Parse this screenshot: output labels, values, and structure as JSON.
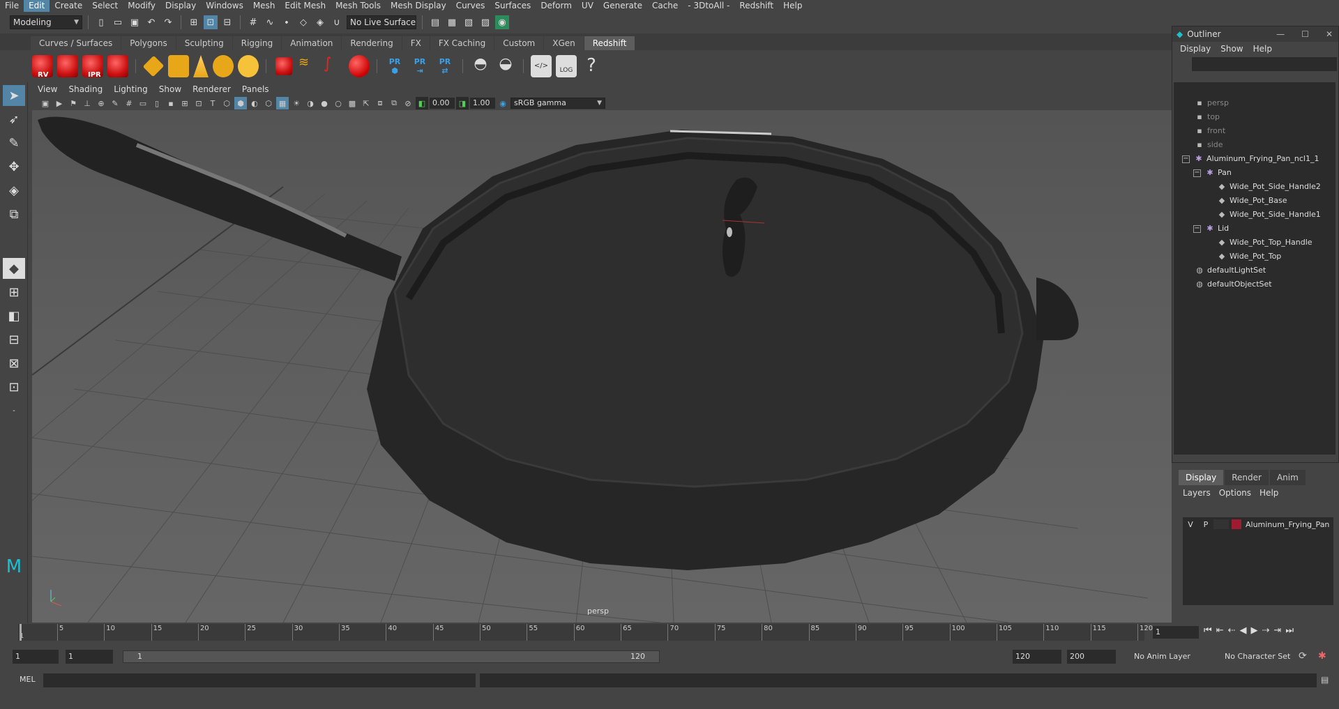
{
  "menubar": [
    "File",
    "Edit",
    "Create",
    "Select",
    "Modify",
    "Display",
    "Windows",
    "Mesh",
    "Edit Mesh",
    "Mesh Tools",
    "Mesh Display",
    "Curves",
    "Surfaces",
    "Deform",
    "UV",
    "Generate",
    "Cache",
    "- 3DtoAll -",
    "Redshift",
    "Help"
  ],
  "statusline": {
    "mode": "Modeling",
    "live_surface": "No Live Surface"
  },
  "shelf_tabs": [
    "Curves / Surfaces",
    "Polygons",
    "Sculpting",
    "Rigging",
    "Animation",
    "Rendering",
    "FX",
    "FX Caching",
    "Custom",
    "XGen",
    "Redshift"
  ],
  "shelf_icons": {
    "rv": "RV",
    "ipr": "IPR",
    "pr1": "PR",
    "pr2": "PR",
    "pr3": "PR",
    "log": "LOG"
  },
  "panel_menu": [
    "View",
    "Shading",
    "Lighting",
    "Show",
    "Renderer",
    "Panels"
  ],
  "panel_tools": {
    "exposure": "0.00",
    "gamma": "1.00",
    "colorspace": "sRGB gamma"
  },
  "viewport": {
    "camera_label": "persp"
  },
  "outliner": {
    "title": "Outliner",
    "menu": [
      "Display",
      "Show",
      "Help"
    ],
    "items": [
      {
        "label": "persp",
        "dim": true
      },
      {
        "label": "top",
        "dim": true
      },
      {
        "label": "front",
        "dim": true
      },
      {
        "label": "side",
        "dim": true
      },
      {
        "label": "Aluminum_Frying_Pan_ncl1_1"
      },
      {
        "label": "Pan"
      },
      {
        "label": "Wide_Pot_Side_Handle2"
      },
      {
        "label": "Wide_Pot_Base"
      },
      {
        "label": "Wide_Pot_Side_Handle1"
      },
      {
        "label": "Lid"
      },
      {
        "label": "Wide_Pot_Top_Handle"
      },
      {
        "label": "Wide_Pot_Top"
      },
      {
        "label": "defaultLightSet"
      },
      {
        "label": "defaultObjectSet"
      }
    ]
  },
  "layer_editor": {
    "tabs": [
      "Display",
      "Render",
      "Anim"
    ],
    "menu": [
      "Layers",
      "Options",
      "Help"
    ],
    "layer": {
      "v": "V",
      "p": "P",
      "name": "Aluminum_Frying_Pan",
      "color": "#9e1b32"
    }
  },
  "timeslider": {
    "ticks": [
      "5",
      "10",
      "15",
      "20",
      "25",
      "30",
      "35",
      "40",
      "45",
      "50",
      "55",
      "60",
      "65",
      "70",
      "75",
      "80",
      "85",
      "90",
      "95",
      "100",
      "105",
      "110",
      "115",
      "120"
    ],
    "first_tick": "1",
    "current_frame": "1"
  },
  "rangeslider": {
    "start": "1",
    "playback_start": "1",
    "range_start_label": "1",
    "range_end_label": "120",
    "playback_end": "120",
    "end": "200",
    "anim_layer": "No Anim Layer",
    "character_set": "No Character Set"
  },
  "cmdline": {
    "label": "MEL"
  },
  "colors": {
    "accent": "#5285a6",
    "viewport_bg": "#5d5d5d",
    "pan": "#2c2c2c"
  }
}
